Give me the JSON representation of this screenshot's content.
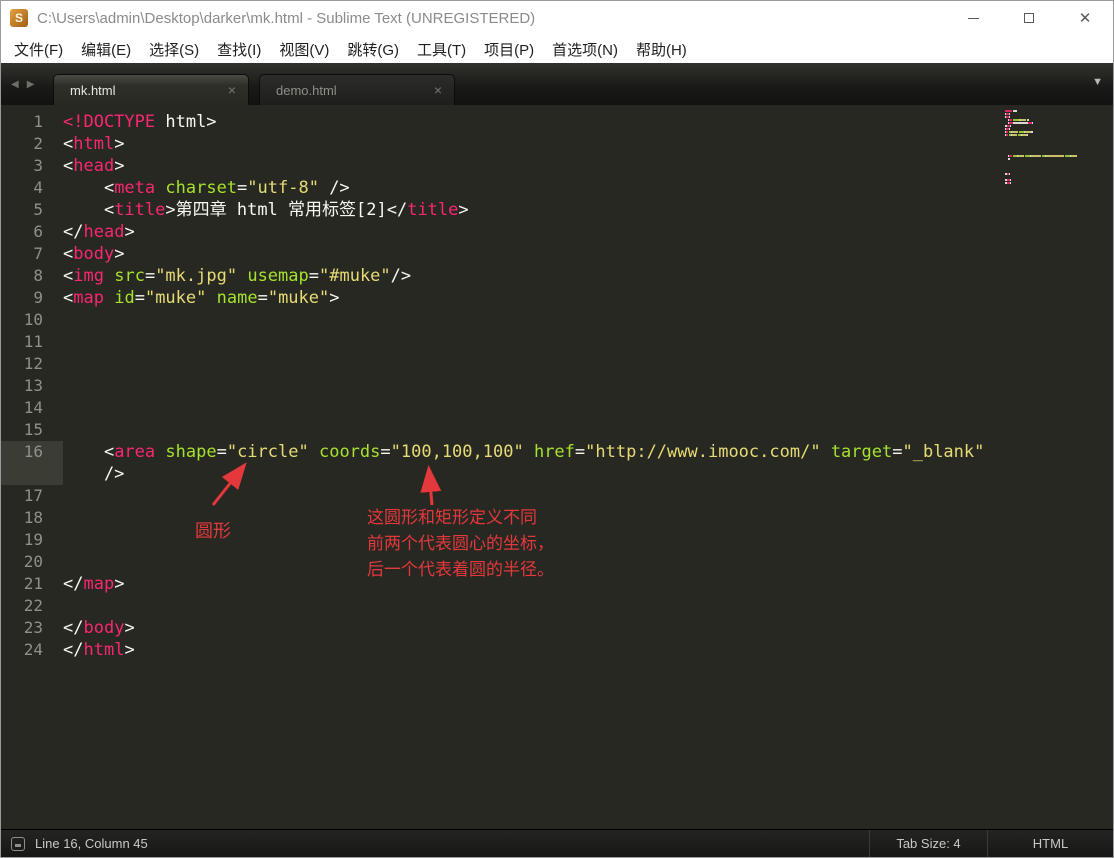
{
  "window": {
    "title": "C:\\Users\\admin\\Desktop\\darker\\mk.html - Sublime Text (UNREGISTERED)",
    "logo_letter": "S"
  },
  "menu": {
    "items": [
      "文件(F)",
      "编辑(E)",
      "选择(S)",
      "查找(I)",
      "视图(V)",
      "跳转(G)",
      "工具(T)",
      "项目(P)",
      "首选项(N)",
      "帮助(H)"
    ]
  },
  "tabs": [
    {
      "label": "mk.html",
      "active": true
    },
    {
      "label": "demo.html",
      "active": false
    }
  ],
  "glyphs": {
    "tab_scroll_left": "◀",
    "tab_scroll_right": "▶",
    "tab_overflow": "▼",
    "tab_close": "×",
    "window_close": "✕"
  },
  "editor": {
    "lines": [
      {
        "n": "1",
        "tokens": [
          [
            "p",
            "<!DOCTYPE"
          ],
          [
            "w",
            " html>"
          ]
        ]
      },
      {
        "n": "2",
        "tokens": [
          [
            "w",
            "<"
          ],
          [
            "p",
            "html"
          ],
          [
            "w",
            ">"
          ]
        ]
      },
      {
        "n": "3",
        "tokens": [
          [
            "w",
            "<"
          ],
          [
            "p",
            "head"
          ],
          [
            "w",
            ">"
          ]
        ]
      },
      {
        "n": "4",
        "tokens": [
          [
            "w",
            "    <"
          ],
          [
            "p",
            "meta"
          ],
          [
            "w",
            " "
          ],
          [
            "g",
            "charset"
          ],
          [
            "w",
            "="
          ],
          [
            "y",
            "\"utf-8\""
          ],
          [
            "w",
            " />"
          ]
        ]
      },
      {
        "n": "5",
        "tokens": [
          [
            "w",
            "    <"
          ],
          [
            "p",
            "title"
          ],
          [
            "w",
            ">第四章 html 常用标签[2]</"
          ],
          [
            "p",
            "title"
          ],
          [
            "w",
            ">"
          ]
        ]
      },
      {
        "n": "6",
        "tokens": [
          [
            "w",
            "</"
          ],
          [
            "p",
            "head"
          ],
          [
            "w",
            ">"
          ]
        ]
      },
      {
        "n": "7",
        "tokens": [
          [
            "w",
            "<"
          ],
          [
            "p",
            "body"
          ],
          [
            "w",
            ">"
          ]
        ]
      },
      {
        "n": "8",
        "tokens": [
          [
            "w",
            "<"
          ],
          [
            "p",
            "img"
          ],
          [
            "w",
            " "
          ],
          [
            "g",
            "src"
          ],
          [
            "w",
            "="
          ],
          [
            "y",
            "\"mk.jpg\""
          ],
          [
            "w",
            " "
          ],
          [
            "g",
            "usemap"
          ],
          [
            "w",
            "="
          ],
          [
            "y",
            "\"#muke\""
          ],
          [
            "w",
            "/>"
          ]
        ]
      },
      {
        "n": "9",
        "tokens": [
          [
            "w",
            "<"
          ],
          [
            "p",
            "map"
          ],
          [
            "w",
            " "
          ],
          [
            "g",
            "id"
          ],
          [
            "w",
            "="
          ],
          [
            "y",
            "\"muke\""
          ],
          [
            "w",
            " "
          ],
          [
            "g",
            "name"
          ],
          [
            "w",
            "="
          ],
          [
            "y",
            "\"muke\""
          ],
          [
            "w",
            ">"
          ]
        ]
      },
      {
        "n": "10",
        "tokens": []
      },
      {
        "n": "11",
        "tokens": []
      },
      {
        "n": "12",
        "tokens": []
      },
      {
        "n": "13",
        "tokens": []
      },
      {
        "n": "14",
        "tokens": []
      },
      {
        "n": "15",
        "tokens": []
      },
      {
        "n": "16",
        "current": true,
        "tokens": [
          [
            "w",
            "    <"
          ],
          [
            "p",
            "area"
          ],
          [
            "w",
            " "
          ],
          [
            "g",
            "shape"
          ],
          [
            "w",
            "="
          ],
          [
            "y",
            "\"circle\""
          ],
          [
            "w",
            " "
          ],
          [
            "g",
            "coords"
          ],
          [
            "w",
            "="
          ],
          [
            "y",
            "\"100,100,100\""
          ],
          [
            "w",
            " "
          ],
          [
            "g",
            "href"
          ],
          [
            "w",
            "="
          ],
          [
            "y",
            "\"http://www.imooc.com/\""
          ],
          [
            "w",
            " "
          ],
          [
            "g",
            "target"
          ],
          [
            "w",
            "="
          ],
          [
            "y",
            "\"_blank\""
          ]
        ]
      },
      {
        "n": "",
        "current": true,
        "tokens": [
          [
            "w",
            "    />"
          ]
        ]
      },
      {
        "n": "17",
        "tokens": []
      },
      {
        "n": "18",
        "tokens": []
      },
      {
        "n": "19",
        "tokens": []
      },
      {
        "n": "20",
        "tokens": []
      },
      {
        "n": "21",
        "tokens": [
          [
            "w",
            "</"
          ],
          [
            "p",
            "map"
          ],
          [
            "w",
            ">"
          ]
        ]
      },
      {
        "n": "22",
        "tokens": []
      },
      {
        "n": "23",
        "tokens": [
          [
            "w",
            "</"
          ],
          [
            "p",
            "body"
          ],
          [
            "w",
            ">"
          ]
        ]
      },
      {
        "n": "24",
        "tokens": [
          [
            "w",
            "</"
          ],
          [
            "p",
            "html"
          ],
          [
            "w",
            ">"
          ]
        ]
      }
    ]
  },
  "annotations": {
    "arrow_label": "圆形",
    "note_lines": [
      "这圆形和矩形定义不同",
      "前两个代表圆心的坐标，",
      "后一个代表着圆的半径。"
    ]
  },
  "status_bar": {
    "cursor": "Line 16, Column 45",
    "tab_size": "Tab Size: 4",
    "syntax": "HTML"
  },
  "colors": {
    "tok-p": "#f92672",
    "tok-w": "#f8f8f2",
    "tok-g": "#a6e22e",
    "tok-y": "#e6db74",
    "editor-bg": "#272822",
    "ann-red": "#e3383c"
  }
}
